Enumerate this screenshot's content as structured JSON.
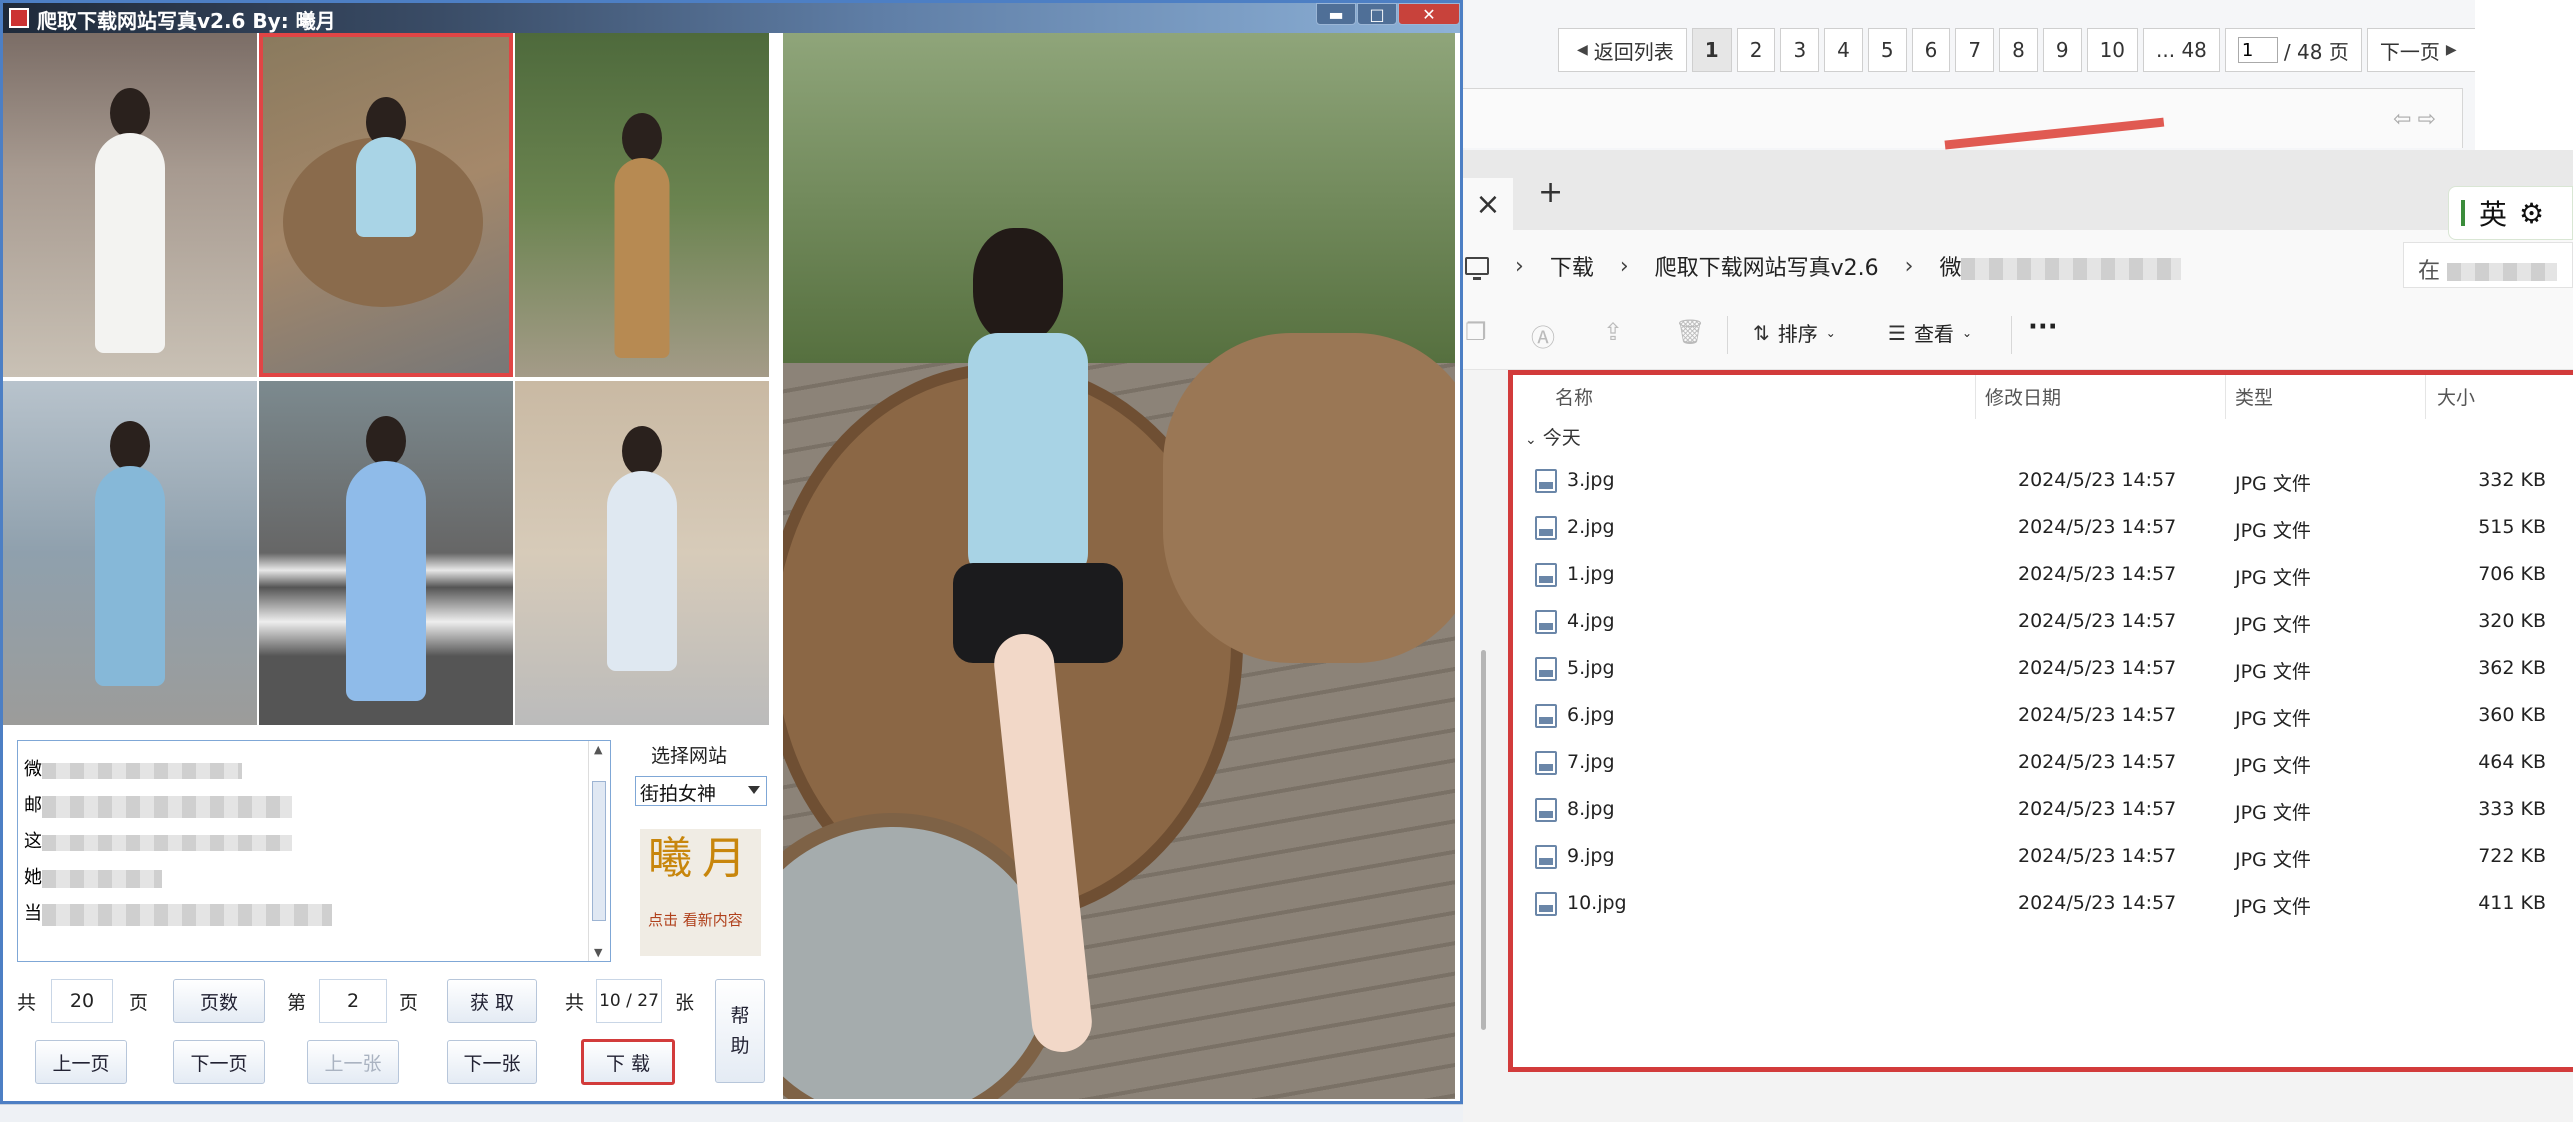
{
  "webpage": {
    "prev_list": "返回列表",
    "pages": [
      "1",
      "2",
      "3",
      "4",
      "5",
      "6",
      "7",
      "8",
      "9",
      "10",
      "... 48"
    ],
    "page_input": "1",
    "page_total": "/ 48 页",
    "next_page": "下一页"
  },
  "explorer": {
    "breadcrumb": [
      "下载",
      "爬取下载网站写真v2.6",
      "微"
    ],
    "search_placeholder": "在",
    "toolbar": {
      "sort": "排序",
      "view": "查看",
      "more": "···"
    },
    "columns": [
      "名称",
      "修改日期",
      "类型",
      "大小"
    ],
    "group": "今天",
    "files": [
      {
        "name": "3.jpg",
        "date": "2024/5/23 14:57",
        "type": "JPG 文件",
        "size": "332 KB"
      },
      {
        "name": "2.jpg",
        "date": "2024/5/23 14:57",
        "type": "JPG 文件",
        "size": "515 KB"
      },
      {
        "name": "1.jpg",
        "date": "2024/5/23 14:57",
        "type": "JPG 文件",
        "size": "706 KB"
      },
      {
        "name": "4.jpg",
        "date": "2024/5/23 14:57",
        "type": "JPG 文件",
        "size": "320 KB"
      },
      {
        "name": "5.jpg",
        "date": "2024/5/23 14:57",
        "type": "JPG 文件",
        "size": "362 KB"
      },
      {
        "name": "6.jpg",
        "date": "2024/5/23 14:57",
        "type": "JPG 文件",
        "size": "360 KB"
      },
      {
        "name": "7.jpg",
        "date": "2024/5/23 14:57",
        "type": "JPG 文件",
        "size": "464 KB"
      },
      {
        "name": "8.jpg",
        "date": "2024/5/23 14:57",
        "type": "JPG 文件",
        "size": "333 KB"
      },
      {
        "name": "9.jpg",
        "date": "2024/5/23 14:57",
        "type": "JPG 文件",
        "size": "722 KB"
      },
      {
        "name": "10.jpg",
        "date": "2024/5/23 14:57",
        "type": "JPG 文件",
        "size": "411 KB"
      }
    ]
  },
  "ime": {
    "lang": "英"
  },
  "app": {
    "title": "爬取下载网站写真v2.6   By:  曦月",
    "select_site_label": "选择网站",
    "site_value": "街拍女神",
    "logo_text": "曦月",
    "logo_sub": "点击 看新内容",
    "total_label": "共",
    "total_pages": "20",
    "page_unit": "页",
    "pages_button": "页数",
    "nth_label": "第",
    "current_page": "2",
    "get_button": "获 取",
    "count_label": "共",
    "count_value": "10 / 27",
    "count_unit": "张",
    "help_button": "帮 助",
    "prev_page": "上一页",
    "next_page": "下一页",
    "prev_image": "上一张",
    "next_image": "下一张",
    "download": "下 载",
    "info_prefixes": [
      "微",
      "邮",
      "这",
      "她",
      "当"
    ]
  },
  "colors": {
    "accent_red": "#d23b3b",
    "window_border": "#4d7fc4"
  }
}
